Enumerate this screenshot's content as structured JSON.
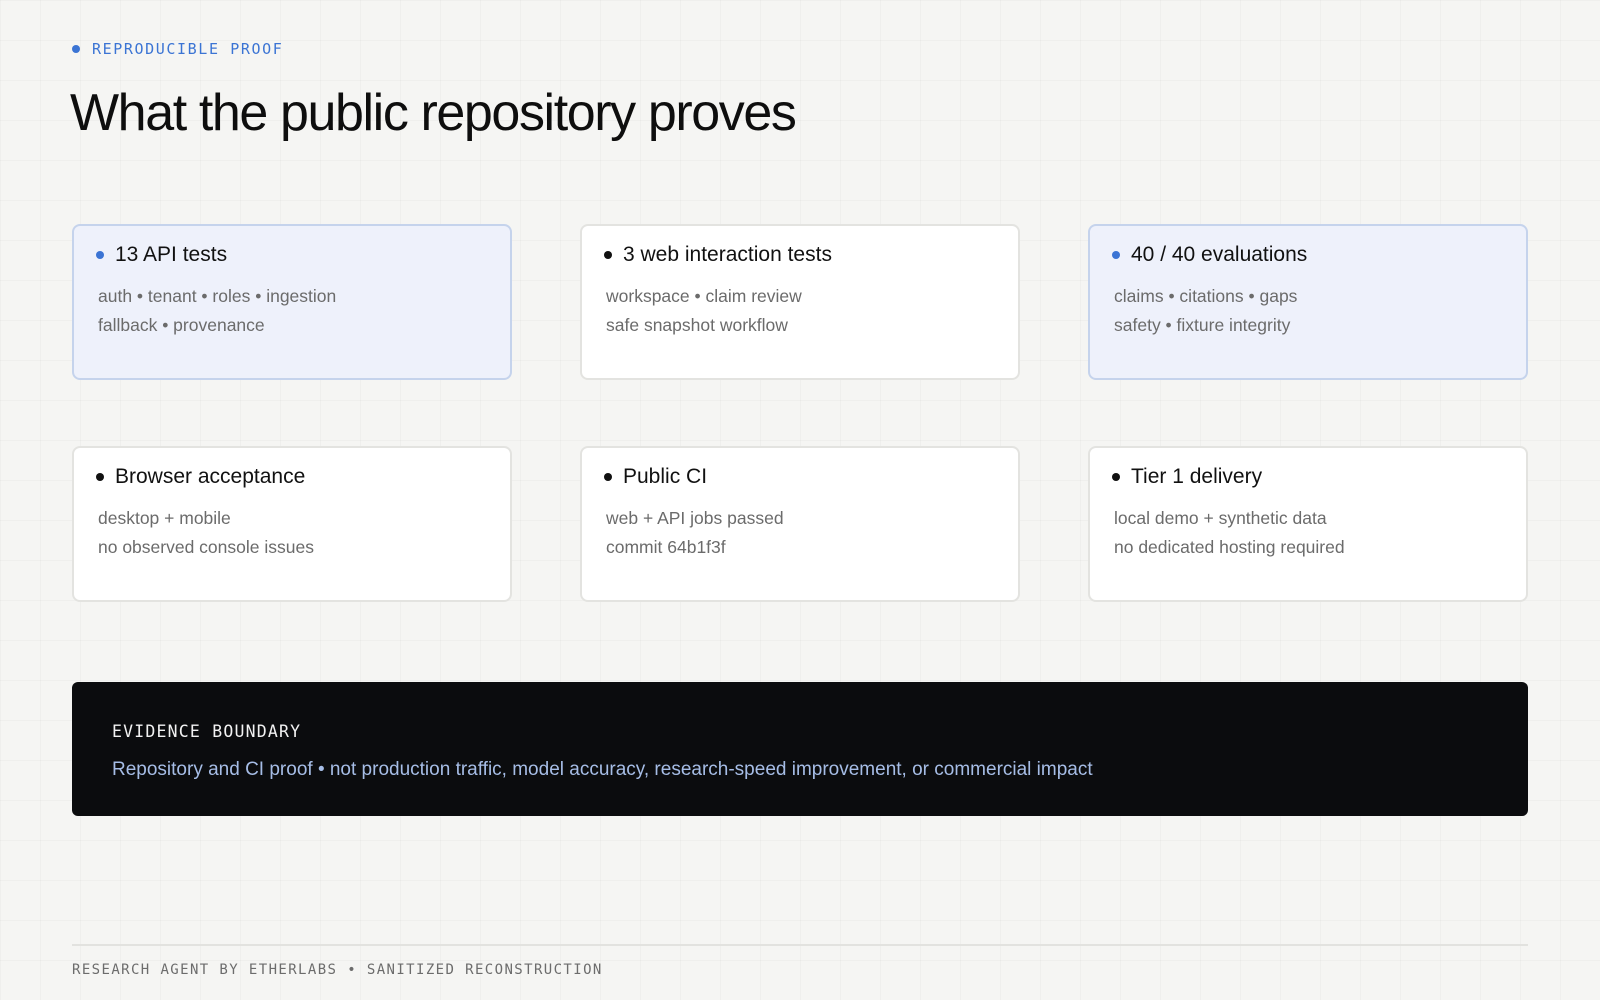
{
  "eyebrow": "REPRODUCIBLE PROOF",
  "title": "What the public repository proves",
  "cards": [
    {
      "title": "13 API tests",
      "lines": [
        "auth • tenant • roles • ingestion",
        "fallback • provenance"
      ],
      "highlight": true
    },
    {
      "title": "3 web interaction tests",
      "lines": [
        "workspace • claim review",
        "safe snapshot workflow"
      ],
      "highlight": false
    },
    {
      "title": "40 / 40 evaluations",
      "lines": [
        "claims • citations • gaps",
        "safety • fixture integrity"
      ],
      "highlight": true
    },
    {
      "title": "Browser acceptance",
      "lines": [
        "desktop + mobile",
        "no observed console issues"
      ],
      "highlight": false
    },
    {
      "title": "Public CI",
      "lines": [
        "web + API jobs passed",
        "commit 64b1f3f"
      ],
      "highlight": false
    },
    {
      "title": "Tier 1 delivery",
      "lines": [
        "local demo + synthetic data",
        "no dedicated hosting required"
      ],
      "highlight": false
    }
  ],
  "evidence": {
    "heading": "EVIDENCE BOUNDARY",
    "text": "Repository and CI proof • not production traffic, model accuracy, research-speed improvement, or commercial impact"
  },
  "footer": "RESEARCH AGENT BY ETHERLABS • SANITIZED RECONSTRUCTION",
  "colors": {
    "accent": "#3b74d4",
    "highlight_card_bg": "#eef1fb",
    "evidence_bg": "#0b0c0e",
    "evidence_text": "#a6bde6"
  }
}
